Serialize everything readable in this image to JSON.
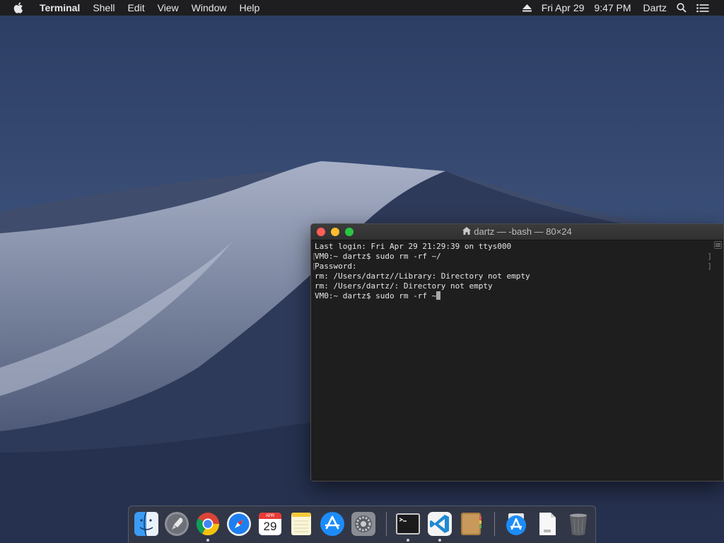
{
  "menubar": {
    "app_name": "Terminal",
    "items": [
      "Shell",
      "Edit",
      "View",
      "Window",
      "Help"
    ],
    "date": "Fri Apr 29",
    "time": "9:47 PM",
    "user": "Dartz"
  },
  "terminal": {
    "title": "dartz — -bash — 80×24",
    "lines": [
      "Last login: Fri Apr 29 21:29:39 on ttys000",
      "VM0:~ dartz$ sudo rm -rf ~/",
      "Password:",
      "rm: /Users/dartz//Library: Directory not empty",
      "rm: /Users/dartz/: Directory not empty",
      "VM0:~ dartz$ sudo rm -rf ~"
    ]
  },
  "dock": {
    "calendar_month": "APR",
    "calendar_day": "29",
    "items": [
      "finder-icon",
      "launchpad-icon",
      "chrome-icon",
      "safari-icon",
      "calendar-icon",
      "notes-icon",
      "app-store-icon",
      "system-preferences-icon",
      "terminal-icon",
      "vscode-icon",
      "contacts-icon",
      "app-store-downloads-icon",
      "text-document-icon",
      "trash-icon"
    ]
  }
}
